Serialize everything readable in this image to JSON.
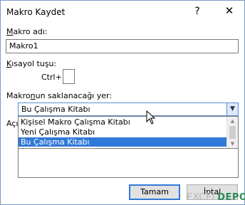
{
  "dialog": {
    "title": "Makro Kaydet",
    "help": "?",
    "close": "✕"
  },
  "macro_name": {
    "label_accel": "M",
    "label_rest": "akro adı:",
    "value": "Makro1"
  },
  "shortcut": {
    "label_accel": "K",
    "label_rest": "ısayol tuşu:",
    "prefix": "Ctrl+",
    "value": ""
  },
  "store_in": {
    "label_pre": "Makro",
    "label_accel": "n",
    "label_rest": "un saklanacağı yer:",
    "selected": "Bu Çalışma Kitabı",
    "options": [
      "Kişisel Makro Çalışma Kitabı",
      "Yeni Çalışma Kitabı",
      "Bu Çalışma Kitabı"
    ],
    "highlighted_index": 2
  },
  "description": {
    "label_partial": "Açı"
  },
  "buttons": {
    "ok": "Tamam",
    "cancel": "İptal"
  },
  "watermark": {
    "part1": "EXCEL",
    "part2": "DEPO"
  }
}
